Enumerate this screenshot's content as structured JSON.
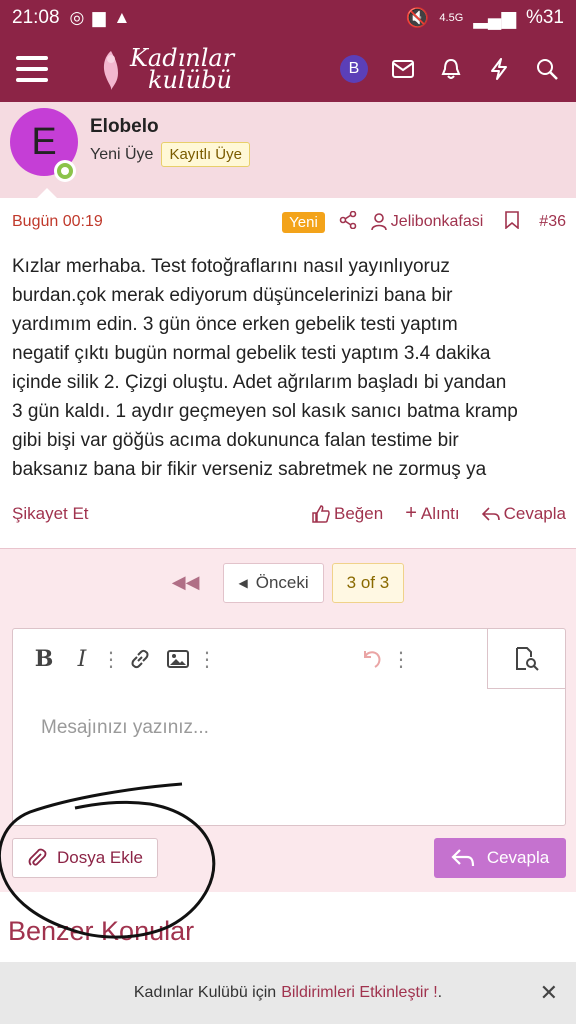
{
  "status_bar": {
    "time": "21:08",
    "network": "4.5G",
    "battery": "%31"
  },
  "header": {
    "logo_line1": "Kadınlar",
    "logo_line2": "kulübü",
    "avatar_letter": "B"
  },
  "author": {
    "avatar_letter": "E",
    "username": "Elobelo",
    "title": "Yeni Üye",
    "badge": "Kayıtlı Üye"
  },
  "post": {
    "date": "Bugün 00:19",
    "new_badge": "Yeni",
    "mention": "Jelibonkafasi",
    "number": "#36",
    "body_lines": [
      "Kızlar merhaba. Test fotoğraflarını nasıl yayınlıyoruz",
      "burdan.çok merak ediyorum düşüncelerinizi bana bir",
      "yardımım edin. 3 gün önce erken gebelik testi yaptım",
      "negatif çıktı bugün normal gebelik testi yaptım 3.4 dakika",
      "içinde silik 2. Çizgi oluştu. Adet ağrılarım başladı bi yandan",
      "3 gün kaldı. 1 aydır geçmeyen sol kasık sanıcı batma kramp",
      "gibi bişi var göğüs acıma dokununca falan testime bir",
      "baksanız bana bir fikir verseniz sabretmek ne zormuş ya"
    ],
    "report": "Şikayet Et",
    "like": "Beğen",
    "quote": "Alıntı",
    "reply": "Cevapla"
  },
  "pager": {
    "prev": "Önceki",
    "current": "3 of 3"
  },
  "editor": {
    "placeholder": "Mesajınızı yazınız...",
    "attach": "Dosya Ekle",
    "submit": "Cevapla"
  },
  "similar": {
    "title": "Benzer Konular"
  },
  "notify": {
    "text": "Kadınlar Kulübü için",
    "link": "Bildirimleri Etkinleştir !",
    "suffix": "."
  },
  "colors": {
    "brand": "#8c2446",
    "accent": "#a0334e",
    "reply_button": "#c572cf",
    "avatar": "#c53ed6"
  }
}
